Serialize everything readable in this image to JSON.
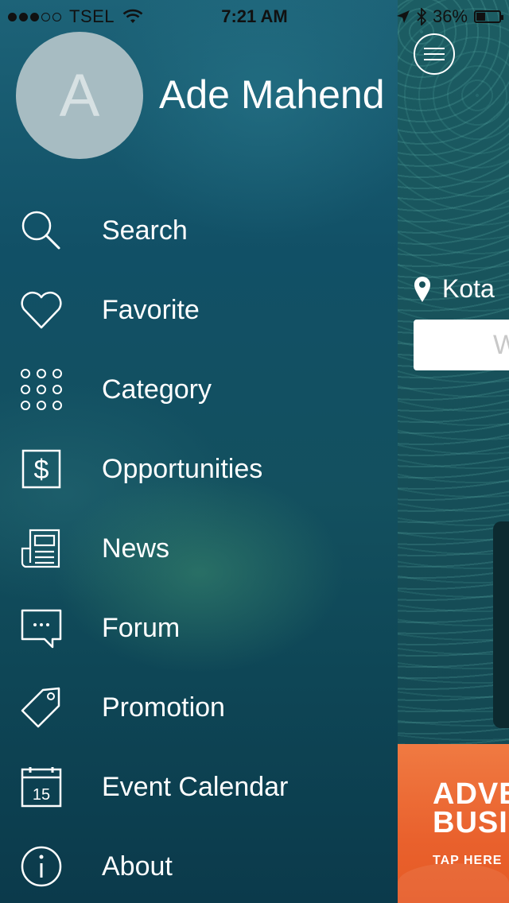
{
  "status_bar": {
    "carrier": "TSEL",
    "time": "7:21 AM",
    "battery": "36%",
    "signal_bars_filled": 3,
    "signal_bars_total": 5
  },
  "profile": {
    "initial": "A",
    "name": "Ade Mahend"
  },
  "menu": [
    {
      "label": "Search",
      "icon": "search-icon"
    },
    {
      "label": "Favorite",
      "icon": "heart-icon"
    },
    {
      "label": "Category",
      "icon": "grid-dots-icon"
    },
    {
      "label": "Opportunities",
      "icon": "dollar-icon"
    },
    {
      "label": "News",
      "icon": "newspaper-icon"
    },
    {
      "label": "Forum",
      "icon": "chat-bubble-icon"
    },
    {
      "label": "Promotion",
      "icon": "tag-icon"
    },
    {
      "label": "Event Calendar",
      "icon": "calendar-icon"
    },
    {
      "label": "About",
      "icon": "info-icon"
    }
  ],
  "calendar_icon_day": "15",
  "main": {
    "location_text": "Kota",
    "search_placeholder": "W",
    "ad": {
      "line1": "ADVE",
      "line2": "BUSI",
      "line3": "TAP HERE"
    }
  },
  "colors": {
    "ad_orange": "#ea622d",
    "drawer_teal": "#115066"
  }
}
